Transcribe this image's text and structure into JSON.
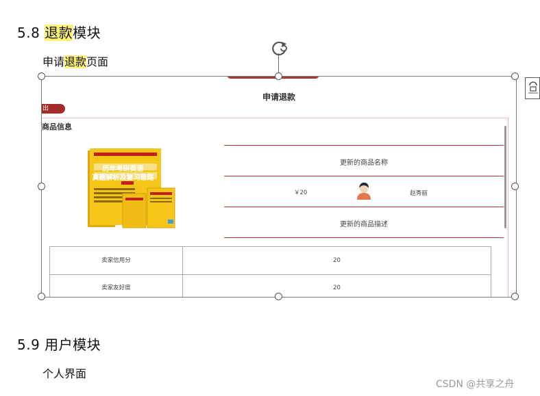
{
  "section_58": {
    "number": "5.8",
    "title_highlight": "退款",
    "title_rest": "模块"
  },
  "para_58": {
    "pre": "申请",
    "highlight": "退款",
    "post": "页面"
  },
  "screenshot": {
    "page_title": "申请退款",
    "back_pill": "出",
    "section_label": "商品信息",
    "product_name": "更新的商品名称",
    "price": "￥20",
    "seller": "赵秀丽",
    "product_desc": "更新的商品描述",
    "table": [
      {
        "label": "卖家信用分",
        "value": "20"
      },
      {
        "label": "卖家友好度",
        "value": "20"
      }
    ],
    "book_lines": [
      "历年考研英语",
      "真题解析及复习思路"
    ]
  },
  "section_59": {
    "number": "5.9",
    "title": "用户模块"
  },
  "para_59": {
    "text": "个人界面"
  },
  "watermark": "CSDN @共享之舟",
  "colors": {
    "highlight": "#fff176",
    "accent_red": "#a52a2a",
    "book_yellow": "#f5c518"
  }
}
